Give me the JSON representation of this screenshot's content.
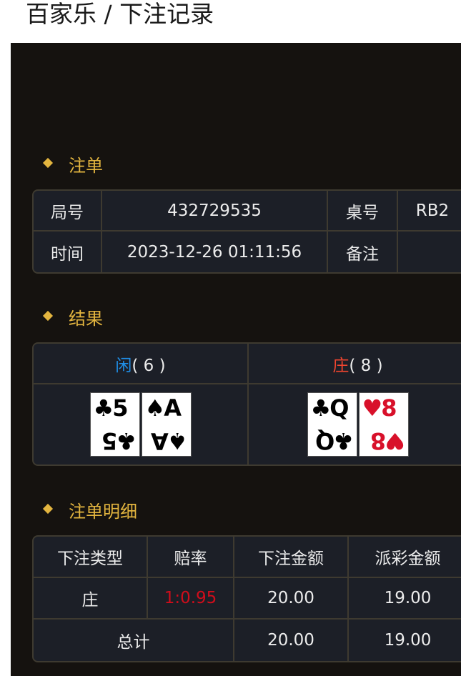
{
  "page": {
    "title": "百家乐 / 下注记录"
  },
  "order": {
    "heading": "注单",
    "round_label": "局号",
    "round_value": "432729535",
    "table_label": "桌号",
    "table_value": "RB2",
    "time_label": "时间",
    "time_value": "2023-12-26 01:11:56",
    "remark_label": "备注",
    "remark_value": ""
  },
  "result": {
    "heading": "结果",
    "player": {
      "label": "闲",
      "score": "( 6 )",
      "cards": [
        {
          "rank": "5",
          "suit": "♣",
          "color": "black"
        },
        {
          "rank": "A",
          "suit": "♠",
          "color": "black"
        }
      ]
    },
    "banker": {
      "label": "庄",
      "score": "( 8 )",
      "cards": [
        {
          "rank": "Q",
          "suit": "♣",
          "color": "black"
        },
        {
          "rank": "8",
          "suit": "♥",
          "color": "red"
        }
      ]
    }
  },
  "details": {
    "heading": "注单明细",
    "headers": [
      "下注类型",
      "赔率",
      "下注金额",
      "派彩金额"
    ],
    "rows": [
      {
        "type": "庄",
        "odds": "1:0.95",
        "bet": "20.00",
        "payout": "19.00"
      }
    ],
    "total": {
      "label": "总计",
      "bet": "20.00",
      "payout": "19.00"
    }
  },
  "colors": {
    "accent": "#e3b53f",
    "odds": "#d00d1b",
    "player": "#1f8fe8",
    "banker": "#f0452f",
    "panel": "#15120f"
  }
}
